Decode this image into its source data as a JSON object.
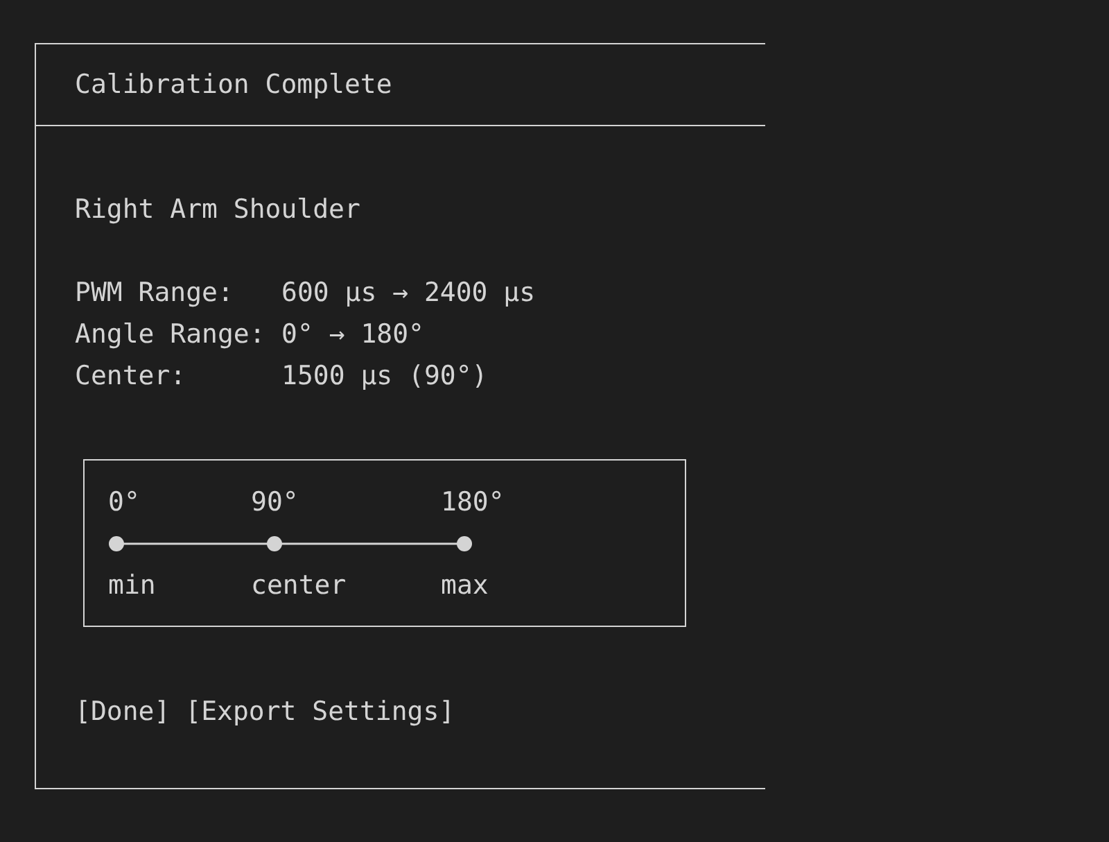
{
  "dialog": {
    "title": "Calibration Complete"
  },
  "joint": "Right Arm Shoulder",
  "specs": [
    {
      "label": "PWM Range:",
      "value": "600 µs → 2400 µs"
    },
    {
      "label": "Angle Range:",
      "value": "0° → 180°"
    },
    {
      "label": "Center:",
      "value": "1500 µs (90°)"
    }
  ],
  "range_diagram": {
    "ticks": [
      {
        "angle": "0°",
        "label": "min"
      },
      {
        "angle": "90°",
        "label": "center"
      },
      {
        "angle": "180°",
        "label": "max"
      }
    ]
  },
  "buttons": [
    "[Done]",
    "[Export Settings]"
  ]
}
